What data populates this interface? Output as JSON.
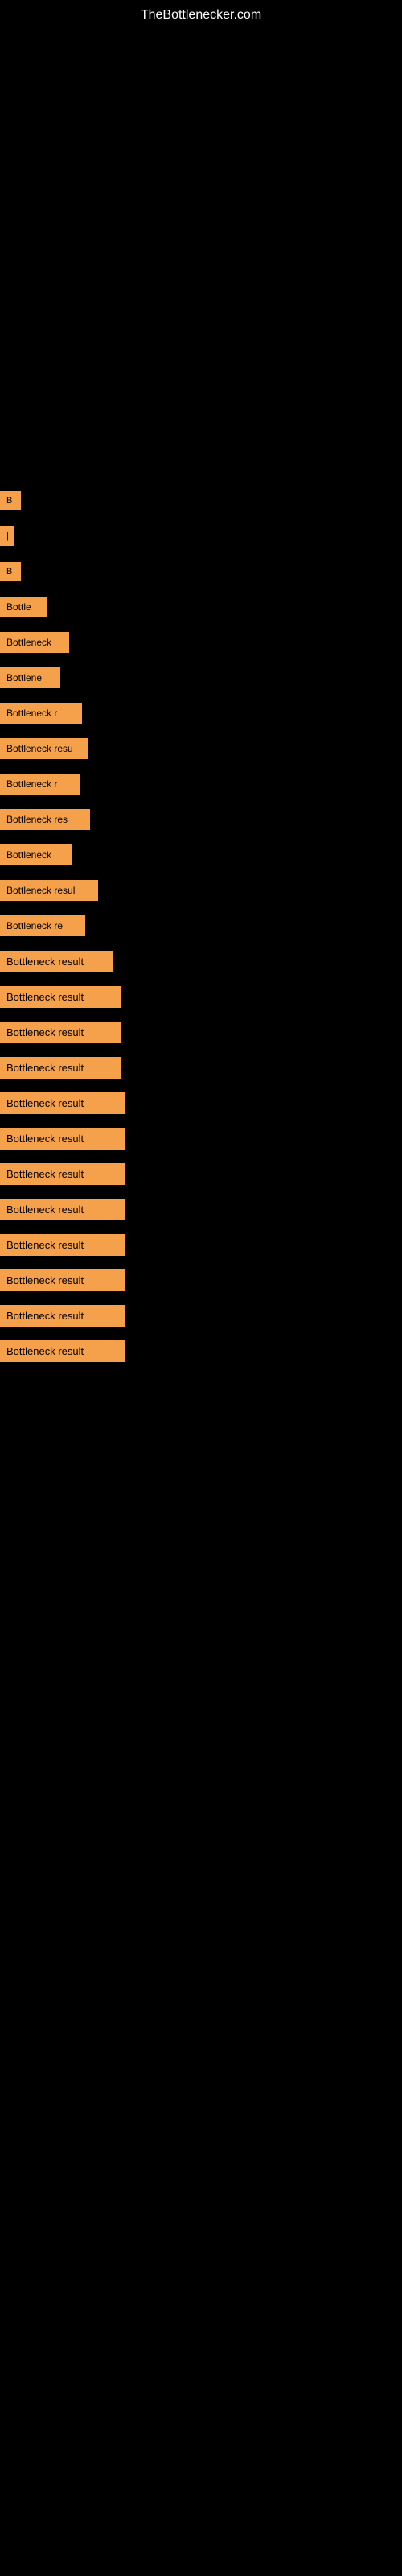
{
  "site": {
    "title": "TheBottlenecker.com"
  },
  "results": [
    {
      "id": 1,
      "label": "B",
      "width": 26
    },
    {
      "id": 2,
      "label": "|",
      "width": 18
    },
    {
      "id": 3,
      "label": "B",
      "width": 26
    },
    {
      "id": 4,
      "label": "Bottle",
      "width": 58
    },
    {
      "id": 5,
      "label": "Bottleneck",
      "width": 86
    },
    {
      "id": 6,
      "label": "Bottlene",
      "width": 75
    },
    {
      "id": 7,
      "label": "Bottleneck r",
      "width": 102
    },
    {
      "id": 8,
      "label": "Bottleneck resu",
      "width": 110
    },
    {
      "id": 9,
      "label": "Bottleneck r",
      "width": 100
    },
    {
      "id": 10,
      "label": "Bottleneck res",
      "width": 112
    },
    {
      "id": 11,
      "label": "Bottleneck",
      "width": 90
    },
    {
      "id": 12,
      "label": "Bottleneck resul",
      "width": 122
    },
    {
      "id": 13,
      "label": "Bottleneck re",
      "width": 106
    },
    {
      "id": 14,
      "label": "Bottleneck result",
      "width": 140
    },
    {
      "id": 15,
      "label": "Bottleneck result",
      "width": 150
    },
    {
      "id": 16,
      "label": "Bottleneck result",
      "width": 150
    },
    {
      "id": 17,
      "label": "Bottleneck result",
      "width": 150
    },
    {
      "id": 18,
      "label": "Bottleneck result",
      "width": 155
    },
    {
      "id": 19,
      "label": "Bottleneck result",
      "width": 155
    },
    {
      "id": 20,
      "label": "Bottleneck result",
      "width": 155
    },
    {
      "id": 21,
      "label": "Bottleneck result",
      "width": 155
    },
    {
      "id": 22,
      "label": "Bottleneck result",
      "width": 155
    },
    {
      "id": 23,
      "label": "Bottleneck result",
      "width": 155
    },
    {
      "id": 24,
      "label": "Bottleneck result",
      "width": 155
    },
    {
      "id": 25,
      "label": "Bottleneck result",
      "width": 155
    }
  ]
}
